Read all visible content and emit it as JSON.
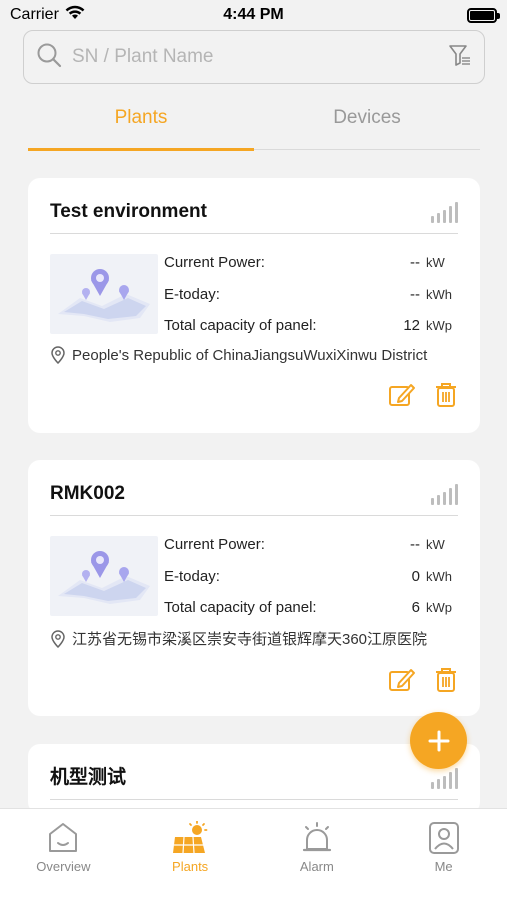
{
  "status_bar": {
    "carrier": "Carrier",
    "time": "4:44 PM"
  },
  "search": {
    "placeholder": "SN / Plant Name"
  },
  "tabs": [
    {
      "label": "Plants",
      "active": true
    },
    {
      "label": "Devices",
      "active": false
    }
  ],
  "plants": [
    {
      "name": "Test environment",
      "current_power_label": "Current Power:",
      "current_power_value": "--",
      "current_power_unit": "kW",
      "etoday_label": "E-today:",
      "etoday_value": "--",
      "etoday_unit": "kWh",
      "capacity_label": "Total capacity of panel:",
      "capacity_value": "12",
      "capacity_unit": "kWp",
      "address": "People's Republic of ChinaJiangsuWuxiXinwu District"
    },
    {
      "name": "RMK002",
      "current_power_label": "Current Power:",
      "current_power_value": "--",
      "current_power_unit": "kW",
      "etoday_label": "E-today:",
      "etoday_value": "0",
      "etoday_unit": "kWh",
      "capacity_label": "Total capacity of panel:",
      "capacity_value": "6",
      "capacity_unit": "kWp",
      "address": "江苏省无锡市梁溪区崇安寺街道银辉摩天360江原医院"
    },
    {
      "name": "机型测试"
    }
  ],
  "bottom_nav": [
    {
      "label": "Overview",
      "icon": "overview-icon",
      "active": false
    },
    {
      "label": "Plants",
      "icon": "plants-icon",
      "active": true
    },
    {
      "label": "Alarm",
      "icon": "alarm-icon",
      "active": false
    },
    {
      "label": "Me",
      "icon": "me-icon",
      "active": false
    }
  ],
  "colors": {
    "accent": "#f5a623",
    "background": "#f2f2f2",
    "card": "#ffffff",
    "muted": "#999999"
  }
}
